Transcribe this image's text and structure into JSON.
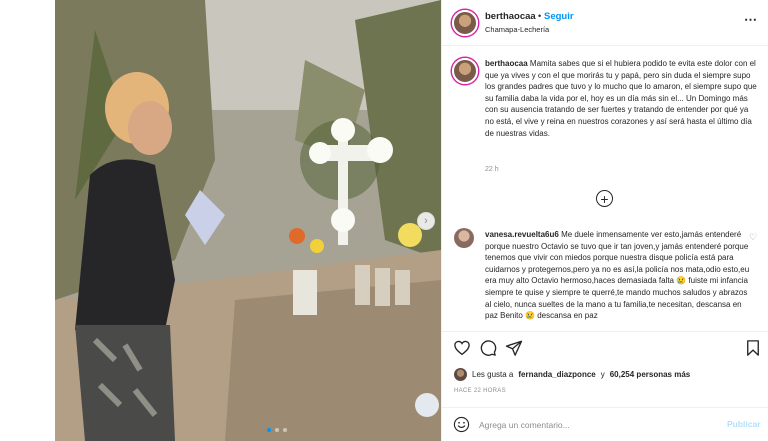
{
  "post": {
    "username": "berthaocaa",
    "bullet": "•",
    "follow_label": "Seguir",
    "location": "Chamapa-Lechería",
    "more_icon": "more-horizontal-icon",
    "media_dots": 3,
    "media_dots_active_index": 0
  },
  "caption": {
    "username": "berthaocaa",
    "text": "Mamita sabes que si el hubiera podido te evita este dolor con el que ya vives y con el que morirás tu y papá, pero sin duda el siempre supo los grandes padres que tuvo y lo mucho que lo amaron, el siempre supo que su familia daba la vida por el, hoy es un día más sin el... Un Domingo más con su ausencia tratando de ser fuertes y tratando de entender por qué ya no está, el vive y reina en nuestros corazones y así será hasta el último día de nuestras vidas.",
    "time_ago": "22 h"
  },
  "comment": {
    "username": "vanesa.revuelta6u6",
    "text": "Me duele inmensamente ver esto,jamás entenderé porque nuestro Octavio se tuvo que ir tan joven,y jamás entenderé porque tenemos que vivir con miedos porque nuestra disque policía está para cuidarnos y protegernos,pero ya no es así,la policía nos mata,odio esto,eu era muy alto Octavio hermoso,haces demasiada falta 😢 fuiste mi infancia siempre te quise y siempre te querré,te mando muchos saludos y abrazos al cielo, nunca sueltes de la mano a tu familia,te necesitan, descansa en paz Benito 😢 descansa en paz"
  },
  "likes": {
    "prefix": "Les gusta a",
    "first_user": "fernanda_diazponce",
    "connector": "y",
    "count_text": "60,254 personas más"
  },
  "posted_ago": "HACE 22 HORAS",
  "add_comment": {
    "placeholder": "Agrega un comentario...",
    "publish_label": "Publicar"
  },
  "colors": {
    "accent": "#0095f6",
    "publish_disabled": "#b2dffc",
    "muted": "#8e8e8e",
    "text": "#262626",
    "border": "#efefef"
  }
}
